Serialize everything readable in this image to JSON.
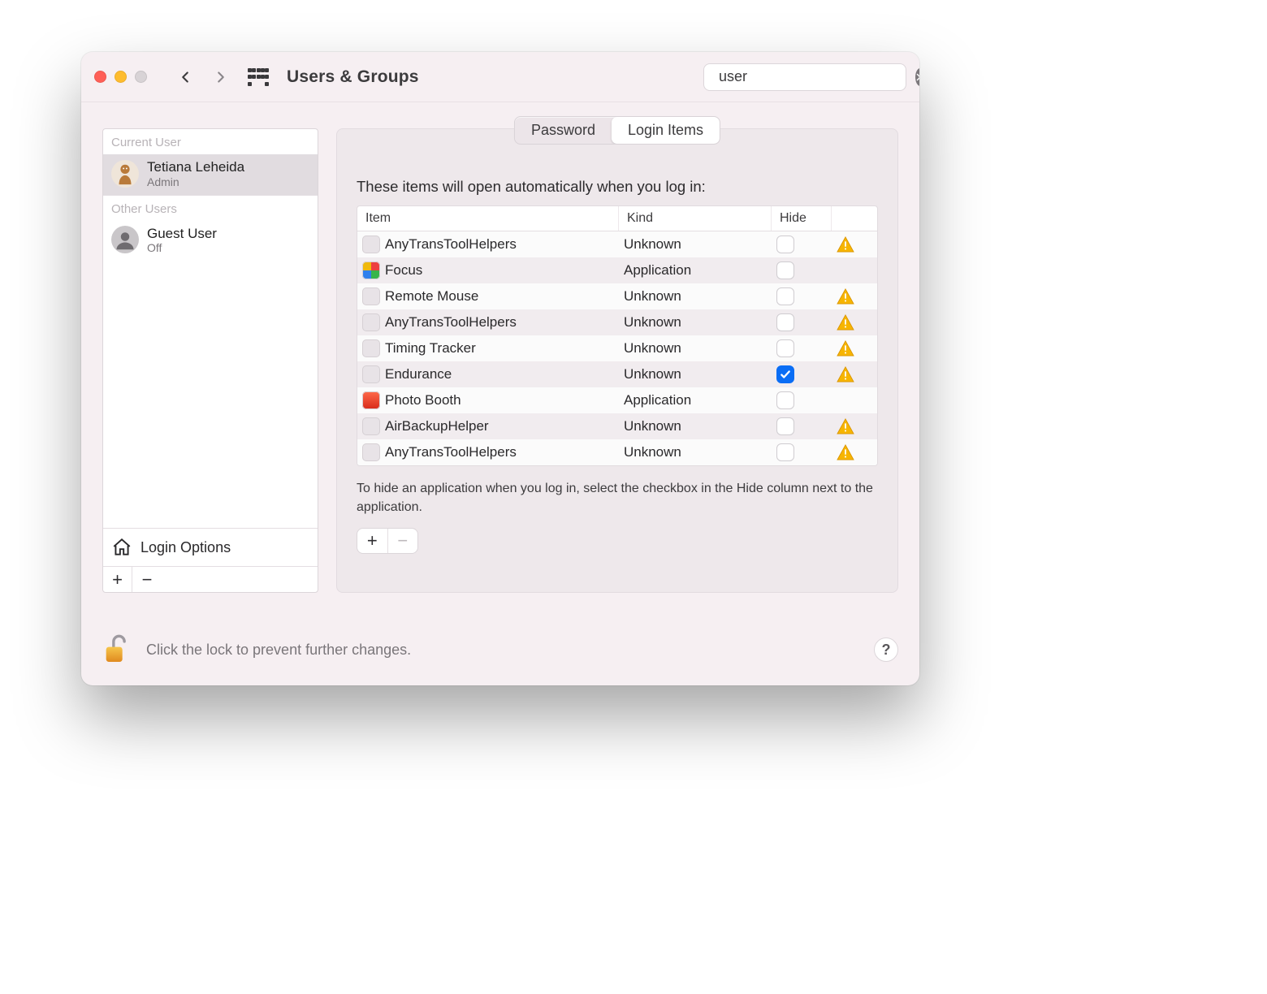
{
  "window": {
    "title": "Users & Groups"
  },
  "search": {
    "value": "user"
  },
  "sidebar": {
    "current_label": "Current User",
    "other_label": "Other Users",
    "current": {
      "name": "Tetiana Leheida",
      "role": "Admin"
    },
    "other": {
      "name": "Guest User",
      "status": "Off"
    },
    "login_options": "Login Options"
  },
  "tabs": {
    "password": "Password",
    "login_items": "Login Items"
  },
  "main": {
    "intro": "These items will open automatically when you log in:",
    "columns": {
      "item": "Item",
      "kind": "Kind",
      "hide": "Hide"
    },
    "rows": [
      {
        "name": "AnyTransToolHelpers",
        "kind": "Unknown",
        "hide": false,
        "warn": true,
        "icon": "generic"
      },
      {
        "name": "Focus",
        "kind": "Application",
        "hide": false,
        "warn": false,
        "icon": "focus"
      },
      {
        "name": "Remote Mouse",
        "kind": "Unknown",
        "hide": false,
        "warn": true,
        "icon": "generic"
      },
      {
        "name": "AnyTransToolHelpers",
        "kind": "Unknown",
        "hide": false,
        "warn": true,
        "icon": "generic"
      },
      {
        "name": "Timing Tracker",
        "kind": "Unknown",
        "hide": false,
        "warn": true,
        "icon": "generic"
      },
      {
        "name": "Endurance",
        "kind": "Unknown",
        "hide": true,
        "warn": true,
        "icon": "generic"
      },
      {
        "name": "Photo Booth",
        "kind": "Application",
        "hide": false,
        "warn": false,
        "icon": "photo"
      },
      {
        "name": "AirBackupHelper",
        "kind": "Unknown",
        "hide": false,
        "warn": true,
        "icon": "generic"
      },
      {
        "name": "AnyTransToolHelpers",
        "kind": "Unknown",
        "hide": false,
        "warn": true,
        "icon": "generic"
      }
    ],
    "hint": "To hide an application when you log in, select the checkbox in the Hide column next to the application."
  },
  "lock": {
    "text": "Click the lock to prevent further changes."
  }
}
